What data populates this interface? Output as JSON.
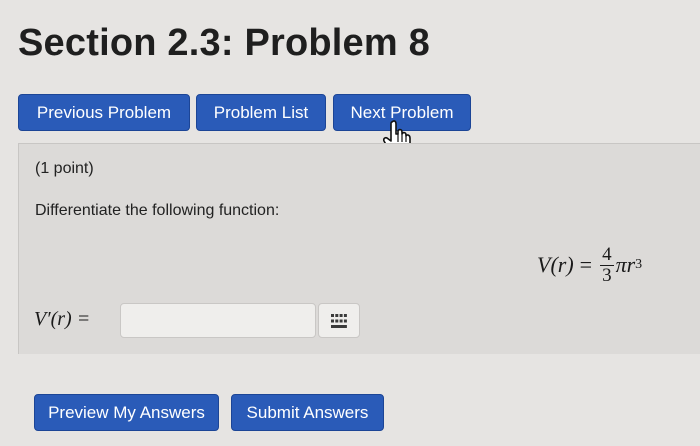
{
  "page": {
    "title": "Section 2.3: Problem 8"
  },
  "nav": {
    "previous_label": "Previous Problem",
    "list_label": "Problem List",
    "next_label": "Next Problem"
  },
  "problem": {
    "points": "(1 point)",
    "instruction": "Differentiate the following function:",
    "function": {
      "lhs": "V(r)",
      "equals": "=",
      "numerator": "4",
      "denominator": "3",
      "tail": "πr",
      "exponent": "3"
    },
    "answer_label": "V′(r) =",
    "answer_value": ""
  },
  "icons": {
    "keypad": "keypad-icon",
    "cursor": "hand-pointer-icon"
  },
  "actions": {
    "preview_label": "Preview My Answers",
    "submit_label": "Submit Answers"
  },
  "colors": {
    "button_bg": "#2a5bb8",
    "button_text": "#ffffff"
  }
}
